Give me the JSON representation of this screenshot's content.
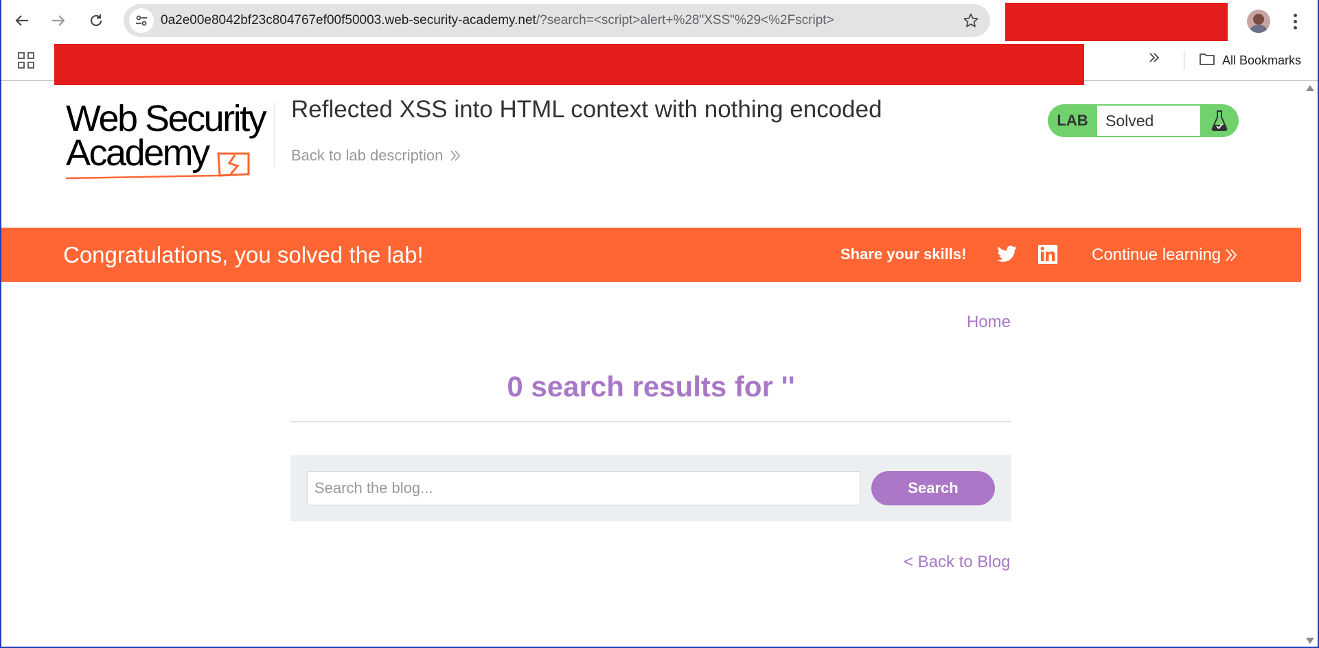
{
  "browser": {
    "url_host": "0a2e00e8042bf23c804767ef00f50003.web-security-academy.net",
    "url_path": "/?search=<script>alert+%28\"XSS\"%29<%2Fscript>",
    "bookmarks_label": "All Bookmarks",
    "icons": [
      "back-arrow-icon",
      "forward-arrow-icon",
      "reload-icon",
      "site-info-icon",
      "bookmark-star-icon",
      "profile-avatar",
      "kebab-menu-icon",
      "apps-grid-icon",
      "chevron-double-right-icon",
      "folder-icon"
    ]
  },
  "header": {
    "logo_line1": "Web Security",
    "logo_line2": "Academy",
    "lab_title": "Reflected XSS into HTML context with nothing encoded",
    "back_to_lab": "Back to lab description",
    "badge_label": "LAB",
    "badge_status": "Solved",
    "badge_color": "#70d16d"
  },
  "banner": {
    "message": "Congratulations, you solved the lab!",
    "share_label": "Share your skills!",
    "continue_label": "Continue learning",
    "color": "#ff6633"
  },
  "main": {
    "home_link": "Home",
    "results_heading": "0 search results for ''",
    "search_placeholder": "Search the blog...",
    "search_button": "Search",
    "back_to_blog": "< Back to Blog",
    "accent_color": "#a878c8"
  }
}
